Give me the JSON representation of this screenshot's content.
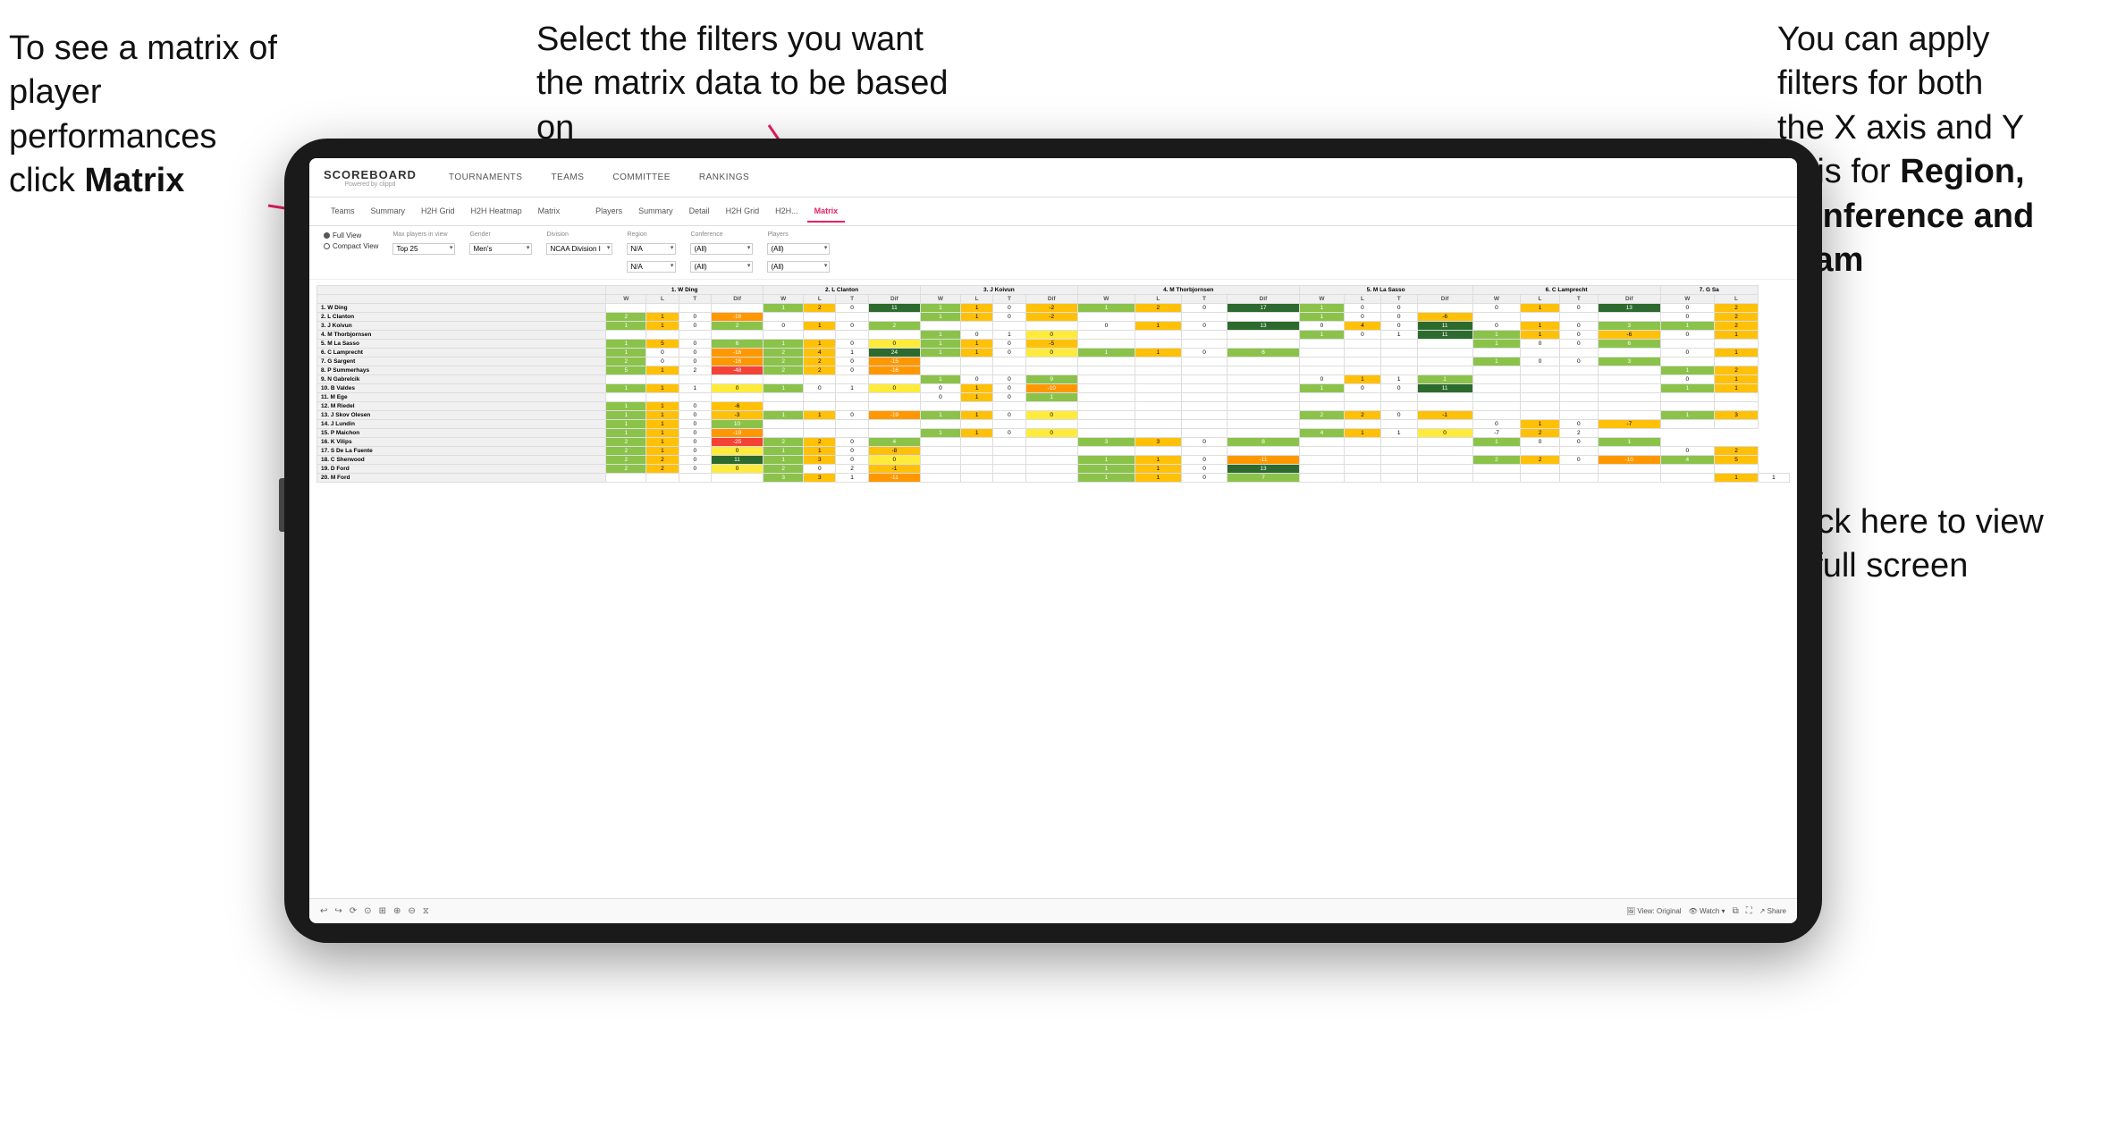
{
  "annotations": {
    "topleft": {
      "line1": "To see a matrix of",
      "line2": "player performances",
      "line3_plain": "click ",
      "line3_bold": "Matrix"
    },
    "topmid": {
      "text": "Select the filters you want the matrix data to be based on"
    },
    "topright": {
      "line1": "You  can apply",
      "line2": "filters for both",
      "line3": "the X axis and Y",
      "line4_plain": "Axis for ",
      "line4_bold": "Region,",
      "line5_bold": "Conference and",
      "line6_bold": "Team"
    },
    "bottomright": {
      "line1": "Click here to view",
      "line2": "in full screen"
    }
  },
  "app": {
    "logo": "SCOREBOARD",
    "logo_sub": "Powered by clippd",
    "nav_items": [
      "TOURNAMENTS",
      "TEAMS",
      "COMMITTEE",
      "RANKINGS"
    ],
    "sub_tabs": [
      "Teams",
      "Summary",
      "H2H Grid",
      "H2H Heatmap",
      "Matrix",
      "Players",
      "Summary",
      "Detail",
      "H2H Grid",
      "H2H...",
      "Matrix"
    ],
    "active_tab": "Matrix",
    "filters": {
      "view_options": [
        "Full View",
        "Compact View"
      ],
      "selected_view": "Full View",
      "max_players_label": "Max players in view",
      "max_players_value": "Top 25",
      "gender_label": "Gender",
      "gender_value": "Men's",
      "division_label": "Division",
      "division_value": "NCAA Division I",
      "region_label": "Region",
      "region_value": "N/A",
      "region_value2": "N/A",
      "conference_label": "Conference",
      "conference_value": "(All)",
      "conference_value2": "(All)",
      "players_label": "Players",
      "players_value": "(All)",
      "players_value2": "(All)"
    },
    "col_headers": [
      "1. W Ding",
      "2. L Clanton",
      "3. J Koivun",
      "4. M Thorbjornsen",
      "5. M La Sasso",
      "6. C Lamprecht",
      "7. G Sa"
    ],
    "col_subheaders": [
      "W",
      "L",
      "T",
      "Dif"
    ],
    "rows": [
      {
        "name": "1. W Ding",
        "cells": [
          "",
          "",
          "",
          "",
          "1",
          "2",
          "0",
          "11",
          "1",
          "1",
          "0",
          "-2",
          "1",
          "2",
          "0",
          "17",
          "1",
          "0",
          "0",
          "",
          "0",
          "1",
          "0",
          "13",
          "0",
          "2"
        ]
      },
      {
        "name": "2. L Clanton",
        "cells": [
          "2",
          "1",
          "0",
          "-16",
          "",
          "",
          "",
          "",
          "1",
          "1",
          "0",
          "-2",
          "",
          "",
          "",
          "",
          "1",
          "0",
          "0",
          "-6",
          "",
          "",
          "",
          "",
          "0",
          "2"
        ]
      },
      {
        "name": "3. J Koivun",
        "cells": [
          "1",
          "1",
          "0",
          "2",
          "0",
          "1",
          "0",
          "2",
          "",
          "",
          "",
          "",
          "0",
          "1",
          "0",
          "13",
          "0",
          "4",
          "0",
          "11",
          "0",
          "1",
          "0",
          "3",
          "1",
          "2"
        ]
      },
      {
        "name": "4. M Thorbjornsen",
        "cells": [
          "",
          "",
          "",
          "",
          "",
          "",
          "",
          "",
          "1",
          "0",
          "1",
          "0",
          "",
          "",
          "",
          "",
          "1",
          "0",
          "1",
          "11",
          "1",
          "1",
          "0",
          "-6",
          "0",
          "1"
        ]
      },
      {
        "name": "5. M La Sasso",
        "cells": [
          "1",
          "5",
          "0",
          "6",
          "1",
          "1",
          "0",
          "0",
          "1",
          "1",
          "0",
          "-5",
          "",
          "",
          "",
          "",
          "",
          "",
          "",
          "",
          "1",
          "0",
          "0",
          "6",
          "",
          ""
        ]
      },
      {
        "name": "6. C Lamprecht",
        "cells": [
          "1",
          "0",
          "0",
          "-16",
          "2",
          "4",
          "1",
          "24",
          "1",
          "1",
          "0",
          "0",
          "1",
          "1",
          "0",
          "6",
          "",
          "",
          "",
          "",
          "",
          "",
          "",
          "",
          "0",
          "1"
        ]
      },
      {
        "name": "7. G Sargent",
        "cells": [
          "2",
          "0",
          "0",
          "-16",
          "2",
          "2",
          "0",
          "-15",
          "",
          "",
          "",
          "",
          "",
          "",
          "",
          "",
          "",
          "",
          "",
          "",
          "1",
          "0",
          "0",
          "3",
          "",
          ""
        ]
      },
      {
        "name": "8. P Summerhays",
        "cells": [
          "5",
          "1",
          "2",
          "-48",
          "2",
          "2",
          "0",
          "-16",
          "",
          "",
          "",
          "",
          "",
          "",
          "",
          "",
          "",
          "",
          "",
          "",
          "",
          "",
          "",
          "",
          "1",
          "2"
        ]
      },
      {
        "name": "9. N Gabrelcik",
        "cells": [
          "",
          "",
          "",
          "",
          "",
          "",
          "",
          "",
          "1",
          "0",
          "0",
          "9",
          "",
          "",
          "",
          "",
          "0",
          "1",
          "1",
          "1",
          "",
          "",
          "",
          "",
          "0",
          "1"
        ]
      },
      {
        "name": "10. B Valdes",
        "cells": [
          "1",
          "1",
          "1",
          "0",
          "1",
          "0",
          "1",
          "0",
          "0",
          "1",
          "0",
          "-10",
          "",
          "",
          "",
          "",
          "1",
          "0",
          "0",
          "11",
          "",
          "",
          "",
          "",
          "1",
          "1"
        ]
      },
      {
        "name": "11. M Ege",
        "cells": [
          "",
          "",
          "",
          "",
          "",
          "",
          "",
          "",
          "0",
          "1",
          "0",
          "1",
          "",
          "",
          "",
          "",
          "",
          "",
          "",
          "",
          "",
          "",
          "",
          "",
          "",
          ""
        ]
      },
      {
        "name": "12. M Riedel",
        "cells": [
          "1",
          "1",
          "0",
          "-6",
          "",
          "",
          "",
          "",
          "",
          "",
          "",
          "",
          "",
          "",
          "",
          "",
          "",
          "",
          "",
          "",
          "",
          "",
          "",
          "",
          "",
          ""
        ]
      },
      {
        "name": "13. J Skov Olesen",
        "cells": [
          "1",
          "1",
          "0",
          "-3",
          "1",
          "1",
          "0",
          "-19",
          "1",
          "1",
          "0",
          "0",
          "",
          "",
          "",
          "",
          "2",
          "2",
          "0",
          "-1",
          "",
          "",
          "",
          "",
          "1",
          "3"
        ]
      },
      {
        "name": "14. J Lundin",
        "cells": [
          "1",
          "1",
          "0",
          "10",
          "",
          "",
          "",
          "",
          "",
          "",
          "",
          "",
          "",
          "",
          "",
          "",
          "",
          "",
          "",
          "",
          "0",
          "1",
          "0",
          "-7",
          "",
          ""
        ]
      },
      {
        "name": "15. P Maichon",
        "cells": [
          "1",
          "1",
          "0",
          "-19",
          "",
          "",
          "",
          "",
          "1",
          "1",
          "0",
          "0",
          "",
          "",
          "",
          "",
          "4",
          "1",
          "1",
          "0",
          "-7",
          "2",
          "2"
        ]
      },
      {
        "name": "16. K Vilips",
        "cells": [
          "2",
          "1",
          "0",
          "-25",
          "2",
          "2",
          "0",
          "4",
          "",
          "",
          "",
          "",
          "3",
          "3",
          "0",
          "8",
          "",
          "",
          "",
          "",
          "1",
          "0",
          "0",
          "1"
        ]
      },
      {
        "name": "17. S De La Fuente",
        "cells": [
          "2",
          "1",
          "0",
          "0",
          "1",
          "1",
          "0",
          "-8",
          "",
          "",
          "",
          "",
          "",
          "",
          "",
          "",
          "",
          "",
          "",
          "",
          "",
          "",
          "",
          "",
          "0",
          "2"
        ]
      },
      {
        "name": "18. C Sherwood",
        "cells": [
          "2",
          "2",
          "0",
          "11",
          "1",
          "3",
          "0",
          "0",
          "",
          "",
          "",
          "",
          "1",
          "1",
          "0",
          "-11",
          "",
          "",
          "",
          "",
          "2",
          "2",
          "0",
          "-10",
          "4",
          "5"
        ]
      },
      {
        "name": "19. D Ford",
        "cells": [
          "2",
          "2",
          "0",
          "0",
          "2",
          "0",
          "2",
          "-1",
          "",
          "",
          "",
          "",
          "1",
          "1",
          "0",
          "13",
          "",
          "",
          "",
          "",
          "",
          "",
          "",
          "",
          "",
          ""
        ]
      },
      {
        "name": "20. M Ford",
        "cells": [
          "",
          "",
          "",
          "",
          "3",
          "3",
          "1",
          "-11",
          "",
          "",
          "",
          "",
          "1",
          "1",
          "0",
          "7",
          "",
          "",
          "",
          "",
          "",
          "",
          "",
          "",
          "",
          "1",
          "1"
        ]
      }
    ],
    "bottom_toolbar": {
      "left_icons": [
        "↩",
        "↪",
        "↩↪",
        "⊙",
        "⊡",
        "⊞",
        "⊟",
        "⧖",
        "⟳"
      ],
      "view_label": "View: Original",
      "watch_label": "Watch ▾",
      "share_label": "Share"
    }
  }
}
